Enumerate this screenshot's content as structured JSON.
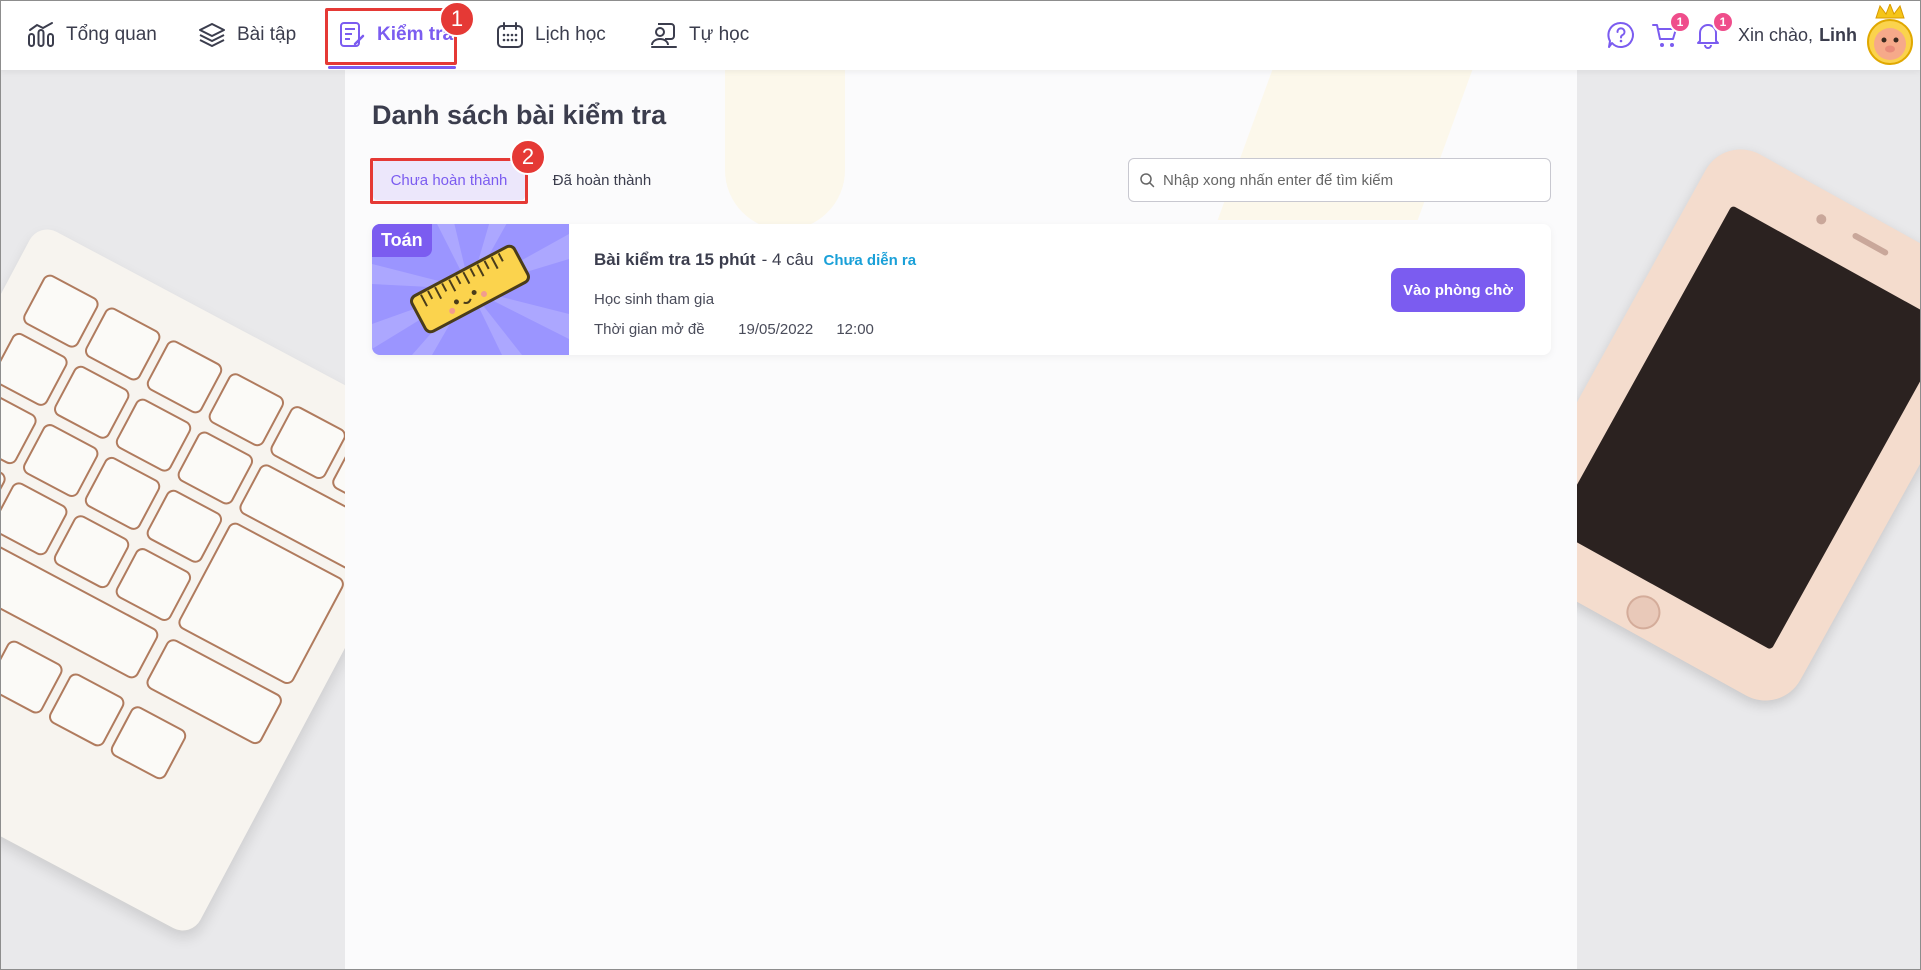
{
  "nav": {
    "items": [
      {
        "label": "Tổng quan",
        "icon": "chart-bars-icon"
      },
      {
        "label": "Bài tập",
        "icon": "layers-icon"
      },
      {
        "label": "Kiểm tra",
        "icon": "test-sheet-icon",
        "active": true
      },
      {
        "label": "Lịch học",
        "icon": "calendar-icon"
      },
      {
        "label": "Tự học",
        "icon": "self-study-icon"
      }
    ],
    "help_icon": "question-icon",
    "cart_icon": "cart-icon",
    "cart_count": "1",
    "bell_icon": "bell-icon",
    "notification_count": "1",
    "greeting_prefix": "Xin chào,",
    "user_name": "Linh"
  },
  "annotations": {
    "step1": "1",
    "step2": "2",
    "highlight_color": "#e53935"
  },
  "page": {
    "title": "Danh sách bài kiểm tra",
    "tabs": [
      {
        "label": "Chưa hoàn thành",
        "active": true
      },
      {
        "label": "Đã hoàn thành",
        "active": false
      }
    ],
    "search_placeholder": "Nhập xong nhấn enter để tìm kiếm"
  },
  "tests": [
    {
      "subject": "Toán",
      "title": "Bài kiểm tra 15 phút",
      "question_count": "- 4 câu",
      "status": "Chưa diễn ra",
      "participants_label": "Học sinh tham gia",
      "open_time_label": "Thời gian mở đề",
      "open_date": "19/05/2022",
      "open_hour": "12:00",
      "action_label": "Vào phòng chờ"
    }
  ],
  "colors": {
    "accent": "#7b5cf0",
    "status": "#1aa0d8",
    "badge": "#ef4d8b"
  }
}
